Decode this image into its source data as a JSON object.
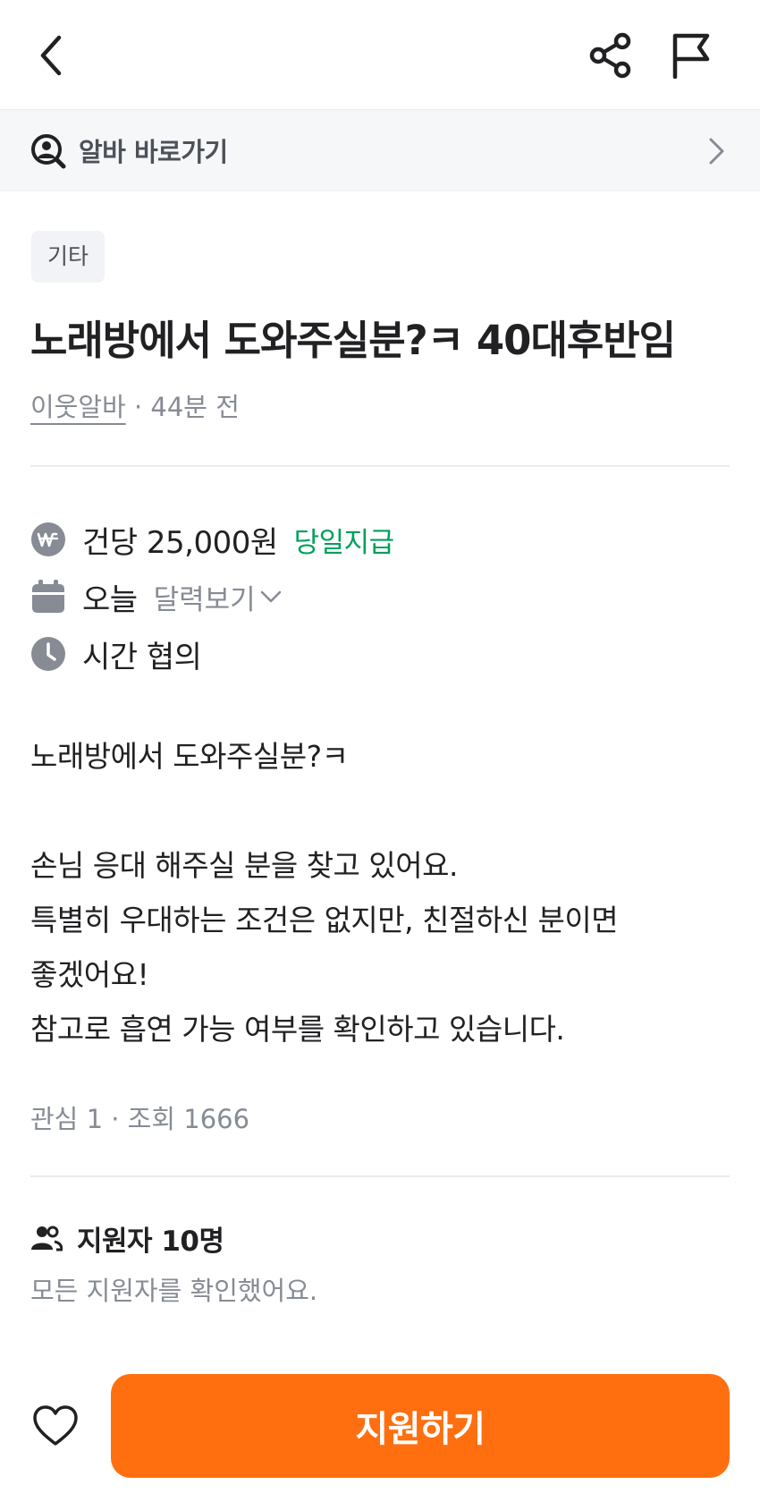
{
  "topbar": {
    "back_icon": "chevron-left-icon",
    "share_icon": "share-icon",
    "report_icon": "flag-icon"
  },
  "shortcut": {
    "icon": "user-search-icon",
    "label": "알바 바로가기",
    "chevron_icon": "chevron-right-icon"
  },
  "post": {
    "category": "기타",
    "title": "노래방에서 도와주실분?ㅋ 40대후반임",
    "author": "이웃알바",
    "meta_separator": " · ",
    "time_ago": "44분 전"
  },
  "info": {
    "pay": {
      "icon": "won-icon",
      "text": "건당 25,000원",
      "tag": "당일지급"
    },
    "date": {
      "icon": "calendar-icon",
      "text": "오늘",
      "link": "달력보기"
    },
    "time": {
      "icon": "clock-icon",
      "text": "시간 협의"
    }
  },
  "description": {
    "line1": "노래방에서 도와주실분?ㅋ",
    "line2": "",
    "line3": "손님 응대 해주실 분을 찾고 있어요.",
    "line4": "특별히 우대하는 조건은 없지만, 친절하신 분이면",
    "line5": "좋겠어요!",
    "line6": "참고로 흡연 가능 여부를 확인하고 있습니다."
  },
  "stats": {
    "text": "관심 1 · 조회 1666"
  },
  "applicants": {
    "icon": "users-icon",
    "title": "지원자 10명",
    "subtitle": "모든 지원자를 확인했어요."
  },
  "bottom": {
    "like_icon": "heart-icon",
    "apply_label": "지원하기"
  },
  "colors": {
    "accent": "#ff6f0f",
    "pay_tag": "#00a05b",
    "muted": "#868b94",
    "text": "#212124"
  }
}
